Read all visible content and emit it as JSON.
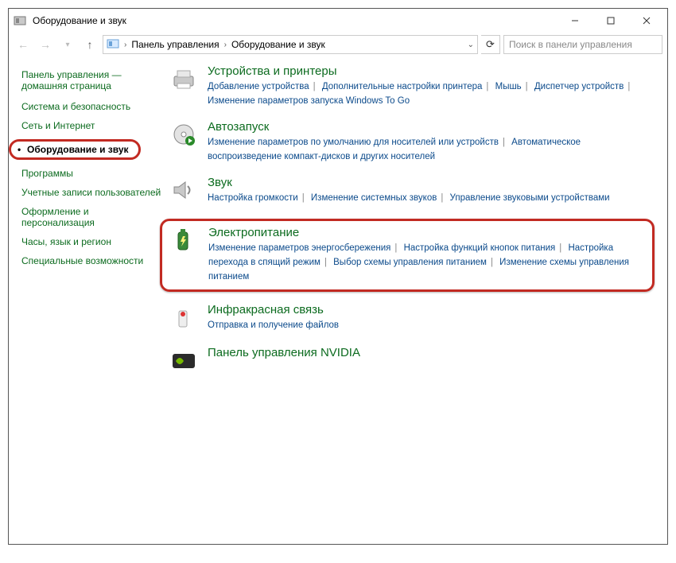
{
  "window": {
    "title": "Оборудование и звук"
  },
  "breadcrumb": {
    "root": "Панель управления",
    "current": "Оборудование и звук"
  },
  "search": {
    "placeholder": "Поиск в панели управления"
  },
  "sidebar": {
    "home": "Панель управления — домашняя страница",
    "items": [
      {
        "label": "Система и безопасность"
      },
      {
        "label": "Сеть и Интернет"
      },
      {
        "label": "Оборудование и звук",
        "selected": true
      },
      {
        "label": "Программы"
      },
      {
        "label": "Учетные записи пользователей"
      },
      {
        "label": "Оформление и персонализация"
      },
      {
        "label": "Часы, язык и регион"
      },
      {
        "label": "Специальные возможности"
      }
    ]
  },
  "categories": {
    "devices": {
      "title": "Устройства и принтеры",
      "links": [
        "Добавление устройства",
        "Дополнительные настройки принтера",
        "Мышь",
        "Диспетчер устройств",
        "Изменение параметров запуска Windows To Go"
      ]
    },
    "autoplay": {
      "title": "Автозапуск",
      "links": [
        "Изменение параметров по умолчанию для носителей или устройств",
        "Автоматическое воспроизведение компакт-дисков и других носителей"
      ]
    },
    "sound": {
      "title": "Звук",
      "links": [
        "Настройка громкости",
        "Изменение системных звуков",
        "Управление звуковыми устройствами"
      ]
    },
    "power": {
      "title": "Электропитание",
      "links": [
        "Изменение параметров энергосбережения",
        "Настройка функций кнопок питания",
        "Настройка перехода в спящий режим",
        "Выбор схемы управления питанием",
        "Изменение схемы управления питанием"
      ]
    },
    "infrared": {
      "title": "Инфракрасная связь",
      "links": [
        "Отправка и получение файлов"
      ]
    },
    "nvidia": {
      "title": "Панель управления NVIDIA",
      "links": []
    }
  },
  "dividers": [
    "|"
  ]
}
